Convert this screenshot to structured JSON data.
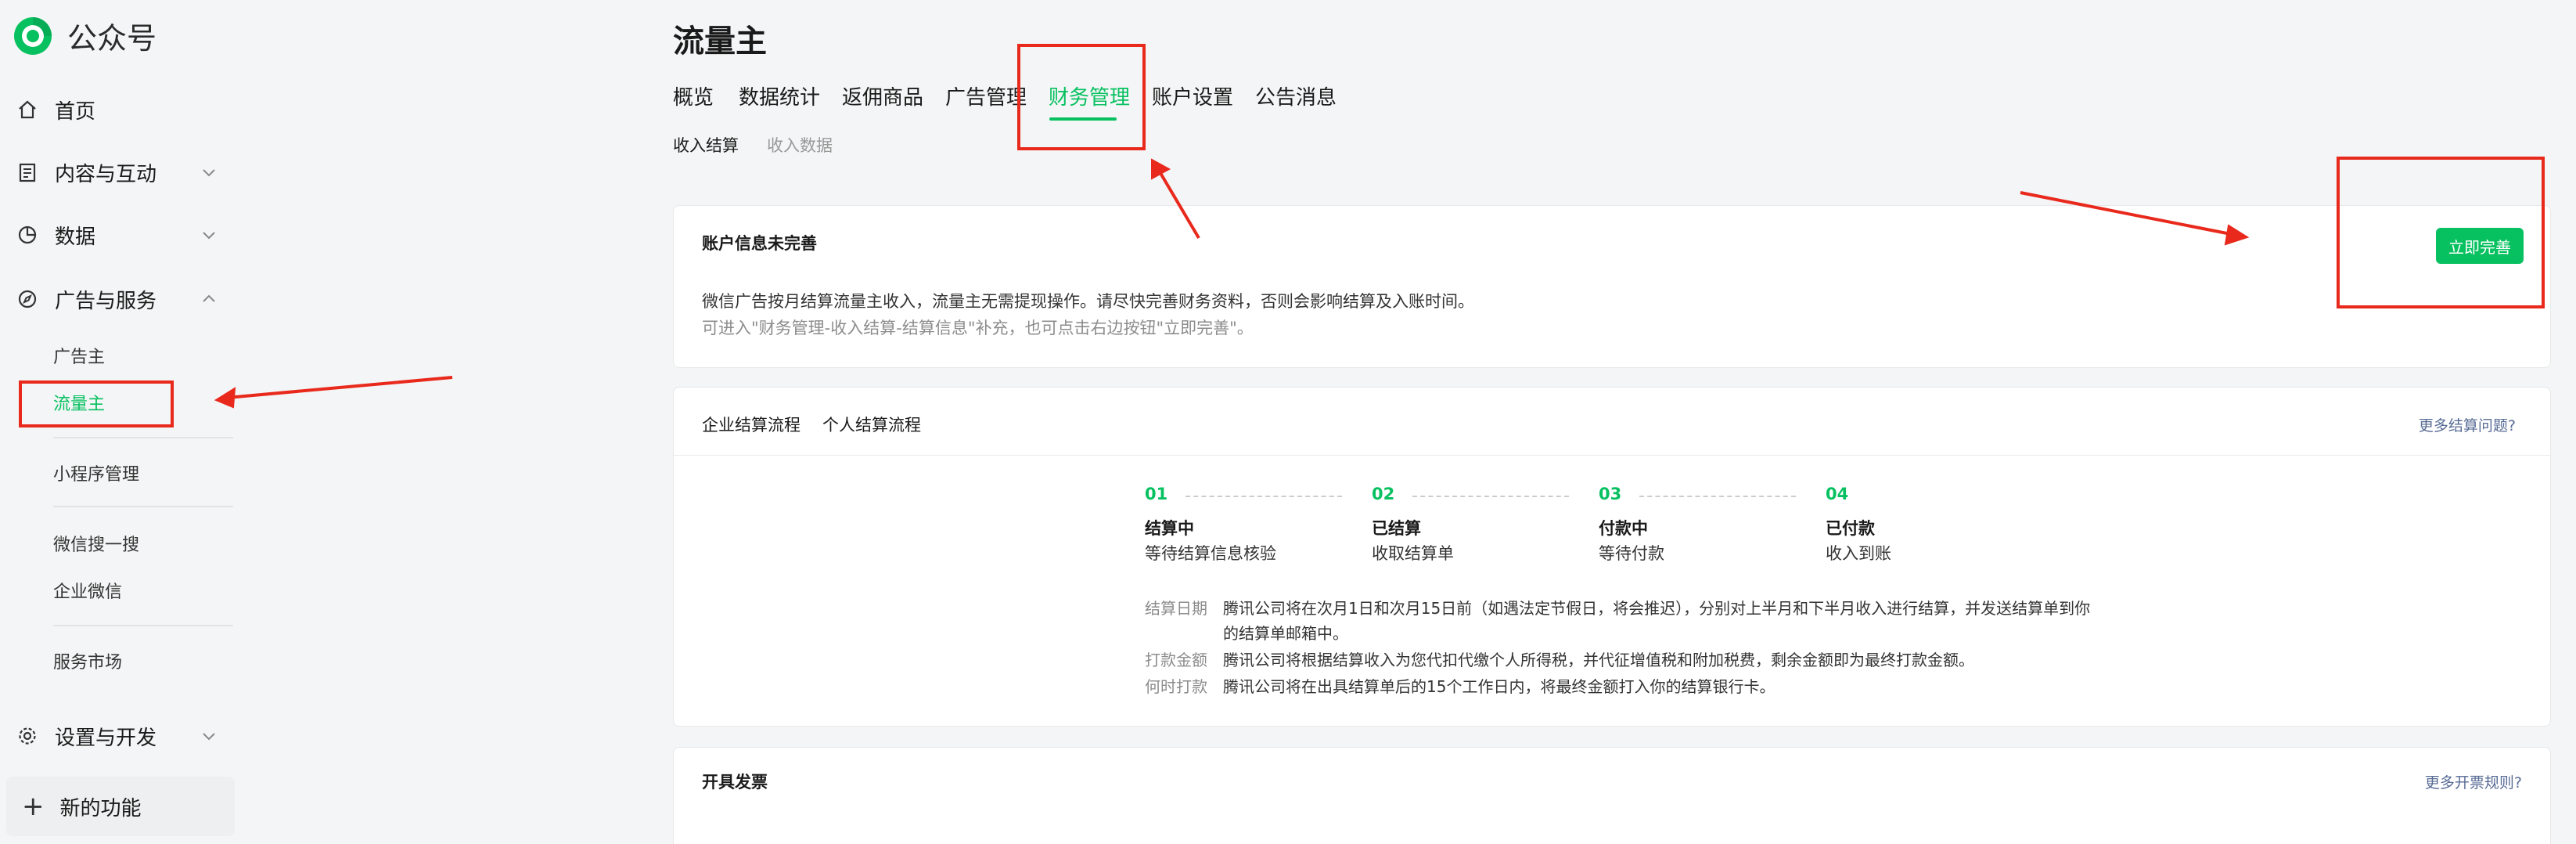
{
  "brand": {
    "name": "公众号",
    "brand_color": "#07c160"
  },
  "sidebar": {
    "items": [
      {
        "label": "首页",
        "icon": "home-icon"
      },
      {
        "label": "内容与互动",
        "icon": "document-icon",
        "chevron": "down"
      },
      {
        "label": "数据",
        "icon": "pie-chart-icon",
        "chevron": "down"
      },
      {
        "label": "广告与服务",
        "icon": "compass-icon",
        "chevron": "up"
      },
      {
        "label": "设置与开发",
        "icon": "gear-icon",
        "chevron": "down"
      }
    ],
    "subitems": [
      "广告主",
      "流量主",
      "小程序管理",
      "微信搜一搜",
      "企业微信",
      "服务市场"
    ],
    "new_feature": "新的功能"
  },
  "page": {
    "title": "流量主"
  },
  "tabs": [
    "概览",
    "数据统计",
    "返佣商品",
    "广告管理",
    "财务管理",
    "账户设置",
    "公告消息"
  ],
  "active_tab": "财务管理",
  "subtabs": [
    "收入结算",
    "收入数据"
  ],
  "notice": {
    "title": "账户信息未完善",
    "line1": "微信广告按月结算流量主收入，流量主无需提现操作。请尽快完善财务资料，否则会影响结算及入账时间。",
    "line2": "可进入\"财务管理-收入结算-结算信息\"补充，也可点击右边按钮\"立即完善\"。",
    "button": "立即完善"
  },
  "settlement": {
    "tabs": [
      "企业结算流程",
      "个人结算流程"
    ],
    "more_link": "更多结算问题?",
    "steps": [
      {
        "num": "01",
        "name": "结算中",
        "desc": "等待结算信息核验"
      },
      {
        "num": "02",
        "name": "已结算",
        "desc": "收取结算单"
      },
      {
        "num": "03",
        "name": "付款中",
        "desc": "等待付款"
      },
      {
        "num": "04",
        "name": "已付款",
        "desc": "收入到账"
      }
    ],
    "info": [
      {
        "label": "结算日期",
        "value": "腾讯公司将在次月1日和次月15日前（如遇法定节假日，将会推迟），分别对上半月和下半月收入进行结算，并发送结算单到你",
        "cont": "的结算单邮箱中。"
      },
      {
        "label": "打款金额",
        "value": "腾讯公司将根据结算收入为您代扣代缴个人所得税，并代征增值税和附加税费，剩余金额即为最终打款金额。"
      },
      {
        "label": "何时打款",
        "value": "腾讯公司将在出具结算单后的15个工作日内，将最终金额打入你的结算银行卡。"
      }
    ]
  },
  "invoice": {
    "title": "开具发票",
    "more_link": "更多开票规则?"
  },
  "annotation_color": "#e8291c"
}
